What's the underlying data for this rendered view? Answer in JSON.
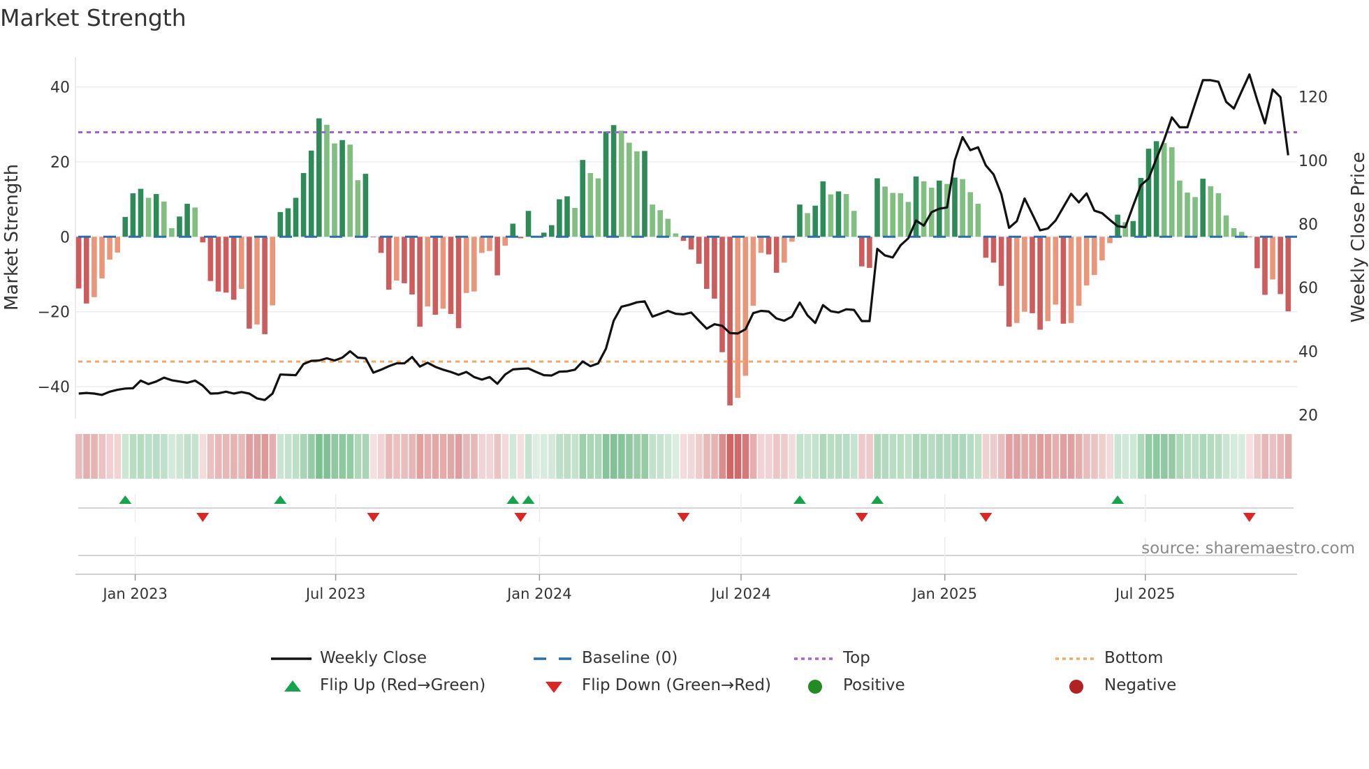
{
  "title": "Market Strength",
  "source": "source: sharemaestro.com",
  "colors": {
    "bar_pos_rising": "#2e8b57",
    "bar_pos_falling": "#80bf80",
    "bar_neg_falling": "#cd5c5c",
    "bar_neg_rising": "#e9967a",
    "close_line": "#111111",
    "baseline": "#2a6fa8",
    "top": "#a461d8",
    "bottom": "#f0a868",
    "flip_up": "#16a34a",
    "flip_down": "#dc2626",
    "positive": "#228b22",
    "negative": "#b22222"
  },
  "legend": {
    "weekly_close": "Weekly Close",
    "baseline": "Baseline (0)",
    "top": "Top",
    "bottom": "Bottom",
    "flip_up": "Flip Up (Red→Green)",
    "flip_down": "Flip Down (Green→Red)",
    "positive": "Positive",
    "negative": "Negative"
  },
  "chart_data": {
    "type": "bar",
    "title": "Market Strength",
    "ylabel": "Market Strength",
    "y2label": "Weekly Close Price",
    "ylim": [
      -48.5,
      48
    ],
    "y2lim": [
      18.6,
      132.4
    ],
    "yticks": [
      "40",
      "20",
      "0",
      "−20",
      "−40"
    ],
    "ytick_values": [
      40,
      20,
      0,
      -20,
      -40
    ],
    "y2ticks": [
      "120",
      "100",
      "80",
      "60",
      "40",
      "20"
    ],
    "y2tick_values": [
      120,
      100,
      80,
      60,
      40,
      20
    ],
    "xticks": [
      "Jan 2023",
      "Jul 2023",
      "Jan 2024",
      "Jul 2024",
      "Jan 2025",
      "Jul 2025"
    ],
    "xtick_dates": [
      "2023-01-01",
      "2023-07-01",
      "2024-01-01",
      "2024-07-01",
      "2025-01-01",
      "2025-07-01"
    ],
    "grid": true,
    "legend_position": "bottom",
    "top_level": 27.9,
    "bottom_level": -33.3,
    "baseline": 0,
    "x": [
      "2022-11-11",
      "2022-11-18",
      "2022-11-25",
      "2022-12-02",
      "2022-12-09",
      "2022-12-16",
      "2022-12-23",
      "2022-12-30",
      "2023-01-06",
      "2023-01-13",
      "2023-01-20",
      "2023-01-27",
      "2023-02-03",
      "2023-02-10",
      "2023-02-17",
      "2023-02-24",
      "2023-03-03",
      "2023-03-10",
      "2023-03-17",
      "2023-03-24",
      "2023-03-31",
      "2023-04-07",
      "2023-04-14",
      "2023-04-21",
      "2023-04-28",
      "2023-05-05",
      "2023-05-12",
      "2023-05-19",
      "2023-05-26",
      "2023-06-02",
      "2023-06-09",
      "2023-06-16",
      "2023-06-23",
      "2023-06-30",
      "2023-07-07",
      "2023-07-14",
      "2023-07-21",
      "2023-07-28",
      "2023-08-04",
      "2023-08-11",
      "2023-08-18",
      "2023-08-25",
      "2023-09-01",
      "2023-09-08",
      "2023-09-15",
      "2023-09-22",
      "2023-09-29",
      "2023-10-06",
      "2023-10-13",
      "2023-10-20",
      "2023-10-27",
      "2023-11-03",
      "2023-11-10",
      "2023-11-17",
      "2023-11-24",
      "2023-12-01",
      "2023-12-08",
      "2023-12-15",
      "2023-12-22",
      "2023-12-29",
      "2024-01-05",
      "2024-01-12",
      "2024-01-19",
      "2024-01-26",
      "2024-02-02",
      "2024-02-09",
      "2024-02-16",
      "2024-02-23",
      "2024-03-01",
      "2024-03-08",
      "2024-03-15",
      "2024-03-22",
      "2024-03-29",
      "2024-04-05",
      "2024-04-12",
      "2024-04-19",
      "2024-04-26",
      "2024-05-03",
      "2024-05-10",
      "2024-05-17",
      "2024-05-24",
      "2024-05-31",
      "2024-06-07",
      "2024-06-14",
      "2024-06-21",
      "2024-06-28",
      "2024-07-05",
      "2024-07-12",
      "2024-07-19",
      "2024-07-26",
      "2024-08-02",
      "2024-08-09",
      "2024-08-16",
      "2024-08-23",
      "2024-08-30",
      "2024-09-06",
      "2024-09-13",
      "2024-09-20",
      "2024-09-27",
      "2024-10-04",
      "2024-10-11",
      "2024-10-18",
      "2024-10-25",
      "2024-11-01",
      "2024-11-08",
      "2024-11-15",
      "2024-11-22",
      "2024-11-29",
      "2024-12-06",
      "2024-12-13",
      "2024-12-20",
      "2024-12-27",
      "2025-01-03",
      "2025-01-10",
      "2025-01-17",
      "2025-01-24",
      "2025-01-31",
      "2025-02-07",
      "2025-02-14",
      "2025-02-21",
      "2025-02-28",
      "2025-03-07",
      "2025-03-14",
      "2025-03-21",
      "2025-03-28",
      "2025-04-04",
      "2025-04-11",
      "2025-04-18",
      "2025-04-25",
      "2025-05-02",
      "2025-05-09",
      "2025-05-16",
      "2025-05-23",
      "2025-05-30",
      "2025-06-06",
      "2025-06-13",
      "2025-06-20",
      "2025-06-27",
      "2025-07-04",
      "2025-07-11",
      "2025-07-18",
      "2025-07-25",
      "2025-08-01",
      "2025-08-08",
      "2025-08-15",
      "2025-08-22",
      "2025-08-29",
      "2025-09-05",
      "2025-09-12",
      "2025-09-19",
      "2025-09-26",
      "2025-10-03",
      "2025-10-10",
      "2025-10-17",
      "2025-10-24",
      "2025-10-31",
      "2025-11-07"
    ],
    "series": [
      {
        "name": "Market Strength",
        "axis": "left",
        "type": "bar",
        "values": [
          -13.8,
          -17.8,
          -16.1,
          -11.1,
          -6.1,
          -4.2,
          5.3,
          11.6,
          12.8,
          10.4,
          11.4,
          9.4,
          2.3,
          5.4,
          8.8,
          7.8,
          -1.5,
          -11.8,
          -14.6,
          -14.9,
          -16.8,
          -13.9,
          -24.5,
          -23.4,
          -26,
          -18.3,
          6.6,
          7.6,
          10.4,
          17,
          23,
          31.6,
          29.9,
          24.9,
          25.8,
          24.6,
          15.1,
          16.8,
          -0.1,
          -4.3,
          -14.1,
          -11.7,
          -12.4,
          -15.4,
          -24,
          -18.6,
          -20.8,
          -19.2,
          -20.6,
          -24.4,
          -15,
          -14.6,
          -4.3,
          -3.8,
          -10.3,
          -2.4,
          3.5,
          -0.4,
          6.9,
          0.1,
          1.1,
          3.1,
          10,
          10.8,
          7.7,
          20.5,
          17,
          15.6,
          28.1,
          29.8,
          28.3,
          25.1,
          22.8,
          22.9,
          8.6,
          7.1,
          4.8,
          0.9,
          -1.1,
          -3.4,
          -7.2,
          -13.9,
          -16.5,
          -30.8,
          -45,
          -43,
          -37.1,
          -18.4,
          -4.3,
          -4.7,
          -9.6,
          -6.9,
          -1.3,
          8.6,
          6.3,
          8.3,
          14.8,
          11.3,
          12.1,
          11.4,
          6.9,
          -7.9,
          -8.3,
          15.6,
          13.4,
          11.7,
          11.6,
          9.3,
          16.1,
          14.8,
          13.1,
          15,
          14.1,
          15.8,
          15.4,
          11.9,
          8.8,
          -5.6,
          -6.9,
          -13.1,
          -24,
          -23,
          -20,
          -20.4,
          -24.8,
          -22.5,
          -18.1,
          -23.2,
          -23,
          -18.4,
          -13,
          -10.2,
          -6.3,
          -1.7,
          5.9,
          3.9,
          4.2,
          15.7,
          23.5,
          25.5,
          25,
          23.9,
          15,
          11.8,
          10.6,
          15.5,
          13.5,
          11.6,
          5.7,
          2.3,
          1.3,
          -0.1,
          -8.4,
          -15.5,
          -11.4,
          -15.3,
          -19.9
        ]
      },
      {
        "name": "Weekly Close",
        "axis": "right",
        "type": "line",
        "values": [
          26.7,
          26.9,
          26.7,
          26.3,
          27.3,
          27.9,
          28.3,
          28.4,
          30.8,
          29.7,
          30.5,
          31.7,
          30.9,
          30.5,
          30.1,
          30.8,
          29.2,
          26.7,
          26.8,
          27.3,
          26.7,
          27.2,
          26.7,
          25.2,
          24.7,
          26.7,
          32.7,
          32.6,
          32.5,
          36,
          37,
          37.1,
          37.8,
          37.1,
          38,
          40,
          38,
          37.8,
          33.3,
          34.2,
          35.3,
          36.2,
          36.2,
          38.2,
          35.2,
          36.4,
          35.1,
          34.2,
          33.5,
          32.6,
          33.5,
          31.9,
          31.1,
          31.9,
          29.8,
          32.7,
          34.3,
          34.5,
          34.6,
          33.5,
          32.5,
          32.4,
          33.6,
          33.7,
          34.2,
          36.8,
          35.3,
          36.2,
          40.8,
          49.6,
          54,
          54.6,
          55.4,
          55.7,
          50.9,
          51.8,
          52.7,
          51.8,
          51.6,
          52.2,
          49.6,
          47.1,
          48.5,
          48,
          45.7,
          45.6,
          46.9,
          52,
          52.7,
          52.5,
          50.3,
          49.6,
          50.9,
          55.3,
          51.3,
          48.9,
          54.5,
          52.6,
          52.2,
          53.2,
          53,
          49.5,
          49.5,
          72.2,
          70.1,
          69.5,
          73.3,
          75.5,
          81.1,
          79.5,
          83.7,
          84.8,
          85.2,
          100,
          107.3,
          103.2,
          104.1,
          98.4,
          95.6,
          89.4,
          78.8,
          80.9,
          88,
          83.1,
          78,
          78.6,
          81.1,
          85.3,
          89.5,
          86.8,
          89.6,
          84.2,
          83.4,
          81.3,
          79.3,
          79,
          85.7,
          92.2,
          94.3,
          100.5,
          106.5,
          113.5,
          110.4,
          110.4,
          117.9,
          125.2,
          125.2,
          124.7,
          118.4,
          116.3,
          121.7,
          127,
          119,
          111.6,
          122.3,
          119.9,
          101.6
        ]
      }
    ],
    "flip_up": [
      "2022-12-23",
      "2023-05-12",
      "2023-12-08",
      "2023-12-22",
      "2024-08-23",
      "2024-11-01",
      "2025-06-06"
    ],
    "flip_down": [
      "2023-03-03",
      "2023-08-04",
      "2023-12-15",
      "2024-05-10",
      "2024-10-18",
      "2025-02-07",
      "2025-10-03"
    ]
  }
}
